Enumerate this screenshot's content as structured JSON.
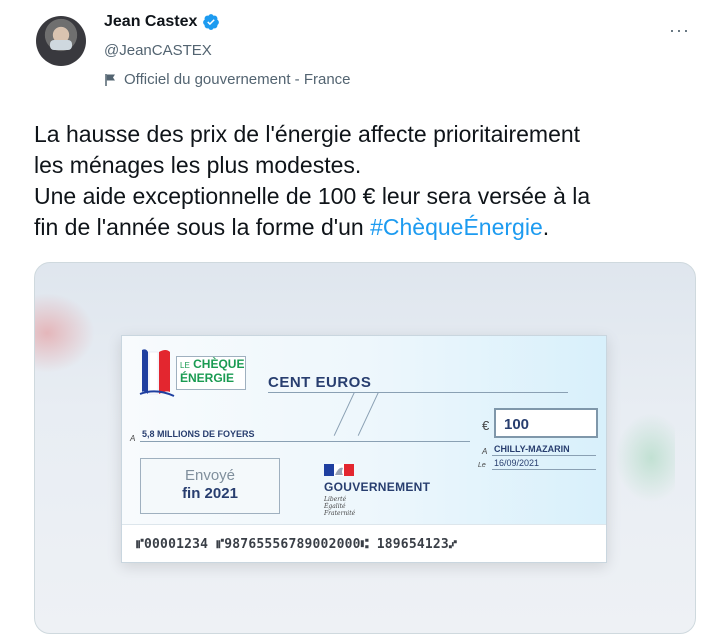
{
  "author": {
    "name": "Jean Castex",
    "handle": "@JeanCASTEX",
    "label": "Officiel du gouvernement - France"
  },
  "more_label": "···",
  "tweet": {
    "line1": "La hausse des prix de l'énergie affecte prioritairement",
    "line2": "les ménages les plus modestes.",
    "line3": "Une aide exceptionnelle de 100 € leur sera versée à la",
    "line4_prefix": "fin de l'année sous la forme d'un ",
    "hashtag": "#ChèqueÉnergie",
    "line4_suffix": "."
  },
  "cheque": {
    "logo_small": "LE",
    "logo_line1": "CHÈQUE",
    "logo_line2": "ÉNERGIE",
    "amount_words": "CENT EUROS",
    "payee_prefix": "A",
    "payee": "5,8 MILLIONS DE FOYERS",
    "currency": "€",
    "amount": "100",
    "place_prefix": "A",
    "place": "CHILLY-MAZARIN",
    "date_prefix": "Le",
    "date": "16/09/2021",
    "sent_line1": "Envoyé",
    "sent_line2": "fin 2021",
    "gov_name": "GOUVERNEMENT",
    "motto1": "Liberté",
    "motto2": "Égalité",
    "motto3": "Fraternité",
    "micr": "⑈00001234  ⑈98765556789002000⑆ 189654123⑇"
  },
  "colors": {
    "hashtag": "#1d9bf0",
    "verified": "#1d9bf0",
    "cheque_blue": "#283e6f",
    "cheque_green": "#1a9b52"
  }
}
